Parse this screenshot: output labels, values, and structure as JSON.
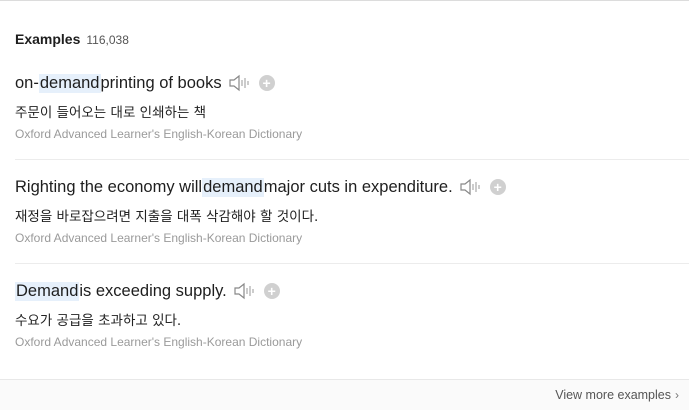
{
  "header": {
    "title": "Examples",
    "count": "116,038"
  },
  "examples": [
    {
      "en_parts": [
        "on-",
        "demand",
        " printing of books"
      ],
      "ko": "주문이 들어오는 대로 인쇄하는 책",
      "source": "Oxford Advanced Learner's English-Korean Dictionary"
    },
    {
      "en_parts": [
        "Righting the economy will ",
        "demand",
        " major cuts in expenditure."
      ],
      "ko": "재정을 바로잡으려면 지출을 대폭 삭감해야 할 것이다.",
      "source": "Oxford Advanced Learner's English-Korean Dictionary"
    },
    {
      "en_parts": [
        "",
        "Demand",
        " is exceeding supply."
      ],
      "ko": "수요가 공급을 초과하고 있다.",
      "source": "Oxford Advanced Learner's English-Korean Dictionary"
    }
  ],
  "footer": {
    "more_label": "View more examples",
    "chevron": "›"
  },
  "icons": {
    "audio": "speaker-icon",
    "add": "plus-icon"
  },
  "colors": {
    "highlight": "#e6f0fb"
  }
}
